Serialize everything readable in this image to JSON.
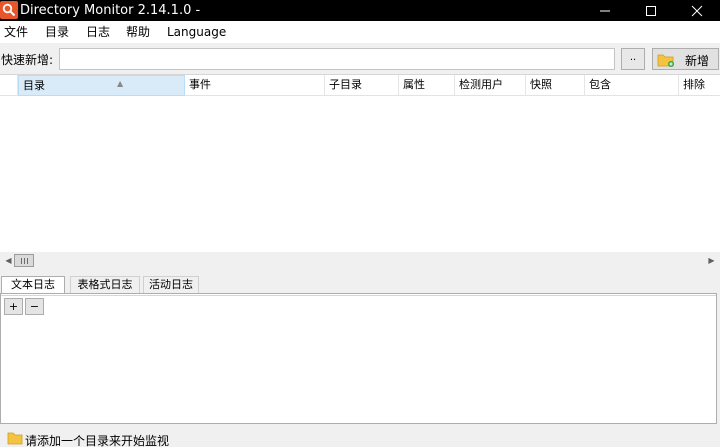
{
  "window": {
    "title": "Directory Monitor 2.14.1.0 -"
  },
  "menu": [
    {
      "label": "文件"
    },
    {
      "label": "目录"
    },
    {
      "label": "日志"
    },
    {
      "label": "帮助"
    },
    {
      "label": "Language"
    }
  ],
  "quick_add": {
    "label": "快速新增:",
    "input_value": "",
    "browse_label": "..",
    "add_label": "新增"
  },
  "grid": {
    "columns": [
      {
        "label": "目录"
      },
      {
        "label": "事件"
      },
      {
        "label": "子目录"
      },
      {
        "label": "属性"
      },
      {
        "label": "检测用户"
      },
      {
        "label": "快照"
      },
      {
        "label": "包含"
      },
      {
        "label": "排除"
      }
    ],
    "rows": []
  },
  "log_tabs": [
    {
      "label": "文本日志",
      "active": true
    },
    {
      "label": "表格式日志",
      "active": false
    },
    {
      "label": "活动日志",
      "active": false
    }
  ],
  "log_buttons": {
    "zoom_in": "+",
    "zoom_out": "−"
  },
  "status": {
    "text": "请添加一个目录来开始监视"
  },
  "colors": {
    "titlebar": "#000000",
    "app_icon": "#e8552a",
    "folder": "#f5c342",
    "sorted_column": "#d9ebf9"
  }
}
